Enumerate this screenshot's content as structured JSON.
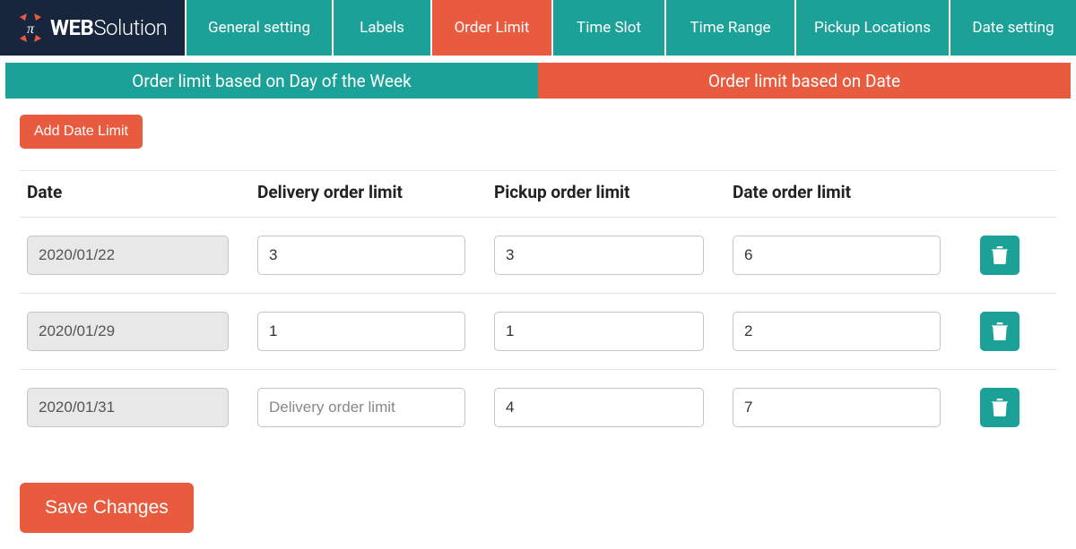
{
  "logo": {
    "bold": "WEB",
    "light": "Solution"
  },
  "nav": {
    "general": "General setting",
    "labels": "Labels",
    "order_limit": "Order Limit",
    "time_slot": "Time Slot",
    "time_range": "Time Range",
    "pickup_locations": "Pickup Locations",
    "date_setting": "Date setting",
    "active": "order_limit"
  },
  "sub_tabs": {
    "left": "Order limit based on Day of the Week",
    "right": "Order limit based on Date"
  },
  "buttons": {
    "add": "Add Date Limit",
    "save": "Save Changes"
  },
  "columns": {
    "date": "Date",
    "delivery": "Delivery order limit",
    "pickup": "Pickup order limit",
    "date_order": "Date order limit"
  },
  "placeholders": {
    "delivery": "Delivery order limit"
  },
  "rows": [
    {
      "date": "2020/01/22",
      "delivery": "3",
      "pickup": "3",
      "date_order": "6"
    },
    {
      "date": "2020/01/29",
      "delivery": "1",
      "pickup": "1",
      "date_order": "2"
    },
    {
      "date": "2020/01/31",
      "delivery": "",
      "pickup": "4",
      "date_order": "7"
    }
  ]
}
